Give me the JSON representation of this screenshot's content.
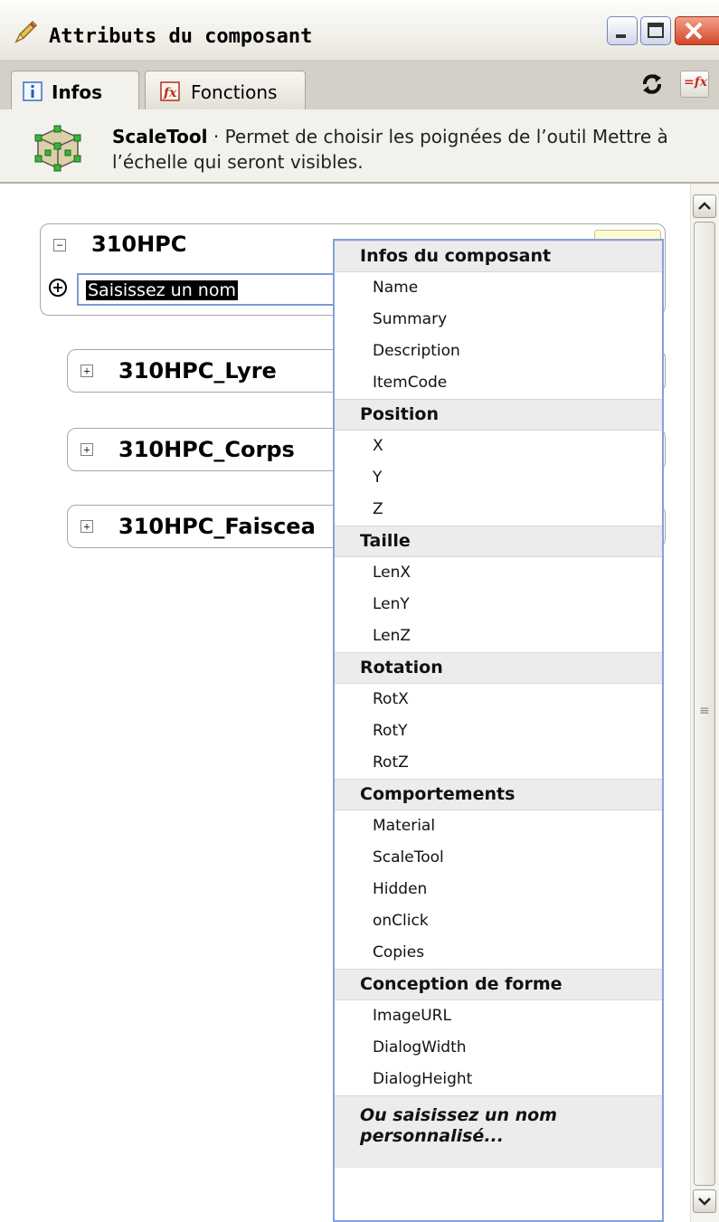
{
  "window": {
    "title": "Attributs du composant",
    "icon": "pencil-icon",
    "buttons": {
      "minimize": "minimize-icon",
      "maximize": "maximize-icon",
      "close": "close-icon"
    }
  },
  "tabs": [
    {
      "label": "Infos",
      "icon": "info-icon",
      "active": true
    },
    {
      "label": "Fonctions",
      "icon": "fx-icon",
      "active": false
    }
  ],
  "toolbar": {
    "refresh_icon": "refresh-icon",
    "fx_icon": "fx-icon",
    "fx_label": "=fx"
  },
  "header": {
    "name": "ScaleTool",
    "separator": " · ",
    "desc_line1": "Permet de choisir les poignées de l’outil Mettre à",
    "desc_line2": "l’échelle qui seront visibles.",
    "icon": "component-cube-icon"
  },
  "tree": {
    "root": {
      "title": "310HPC",
      "toggle": "−",
      "input_value": "Saisissez un nom",
      "add_icon": "+"
    },
    "children": [
      {
        "title": "310HPC_Lyre",
        "toggle": "+"
      },
      {
        "title": "310HPC_Corps",
        "toggle": "+"
      },
      {
        "title": "310HPC_Faiscea",
        "toggle": "+"
      }
    ]
  },
  "menu": {
    "sections": [
      {
        "title": "Infos du composant",
        "items": [
          "Name",
          "Summary",
          "Description",
          "ItemCode"
        ]
      },
      {
        "title": "Position",
        "items": [
          "X",
          "Y",
          "Z"
        ]
      },
      {
        "title": "Taille",
        "items": [
          "LenX",
          "LenY",
          "LenZ"
        ]
      },
      {
        "title": "Rotation",
        "items": [
          "RotX",
          "RotY",
          "RotZ"
        ]
      },
      {
        "title": "Comportements",
        "items": [
          "Material",
          "ScaleTool",
          "Hidden",
          "onClick",
          "Copies"
        ]
      },
      {
        "title": "Conception de forme",
        "items": [
          "ImageURL",
          "DialogWidth",
          "DialogHeight"
        ]
      }
    ],
    "custom_line1": "Ou saisissez un nom",
    "custom_line2": "personnalisé..."
  },
  "colors": {
    "accent": "#7fa3de",
    "close_button": "#d1462a",
    "section_bg": "#ececec"
  }
}
